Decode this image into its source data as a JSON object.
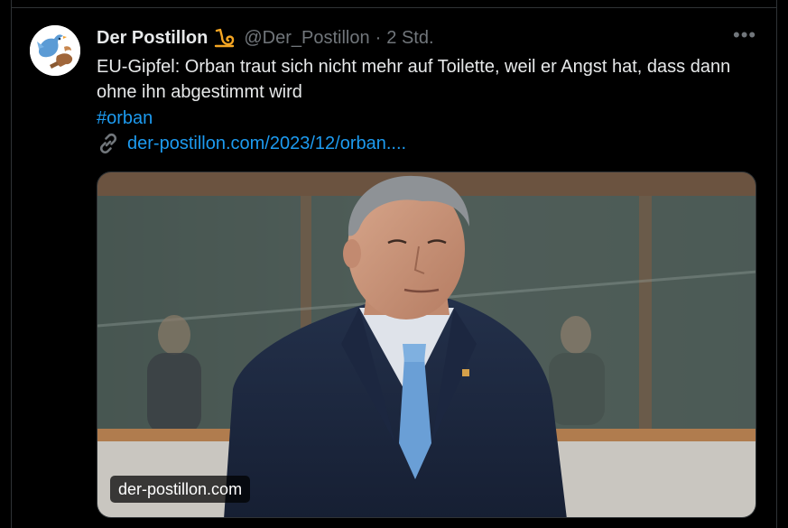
{
  "tweet": {
    "display_name": "Der Postillon",
    "handle": "@Der_Postillon",
    "separator": "·",
    "time": "2 Std.",
    "text": "EU-Gipfel: Orban traut sich nicht mehr auf Toilette, weil er Angst hat, dass dann ohne ihn abgestimmt wird",
    "hashtag": "#orban",
    "link_text": "der-postillon.com/2023/12/orban....",
    "more_label": "•••"
  },
  "card": {
    "domain": "der-postillon.com"
  },
  "icons": {
    "avatar": "bird-with-horn-logo",
    "badge": "postal-horn-icon",
    "link": "link-chain-icon",
    "more": "more-dots-icon"
  },
  "colors": {
    "background": "#000000",
    "text": "#e7e9ea",
    "muted": "#71767b",
    "link": "#1d9bf0",
    "border": "#2f3336",
    "badge_orange": "#f5a623"
  }
}
